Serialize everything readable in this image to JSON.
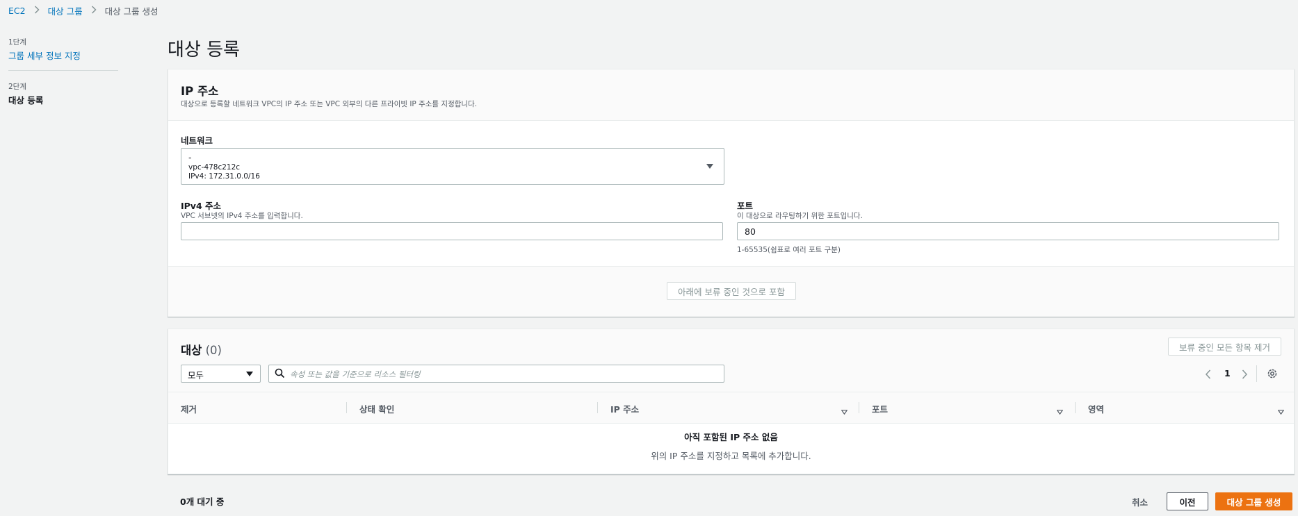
{
  "breadcrumb": {
    "items": [
      "EC2",
      "대상 그룹",
      "대상 그룹 생성"
    ]
  },
  "steps": [
    {
      "num": "1단계",
      "label": "그룹 세부 정보 지정"
    },
    {
      "num": "2단계",
      "label": "대상 등록"
    }
  ],
  "page_title": "대상 등록",
  "ip_panel": {
    "title": "IP 주소",
    "description": "대상으로 등록할 네트워크 VPC의 IP 주소 또는 VPC 외부의 다른 프라이빗 IP 주소를 지정합니다.",
    "network_label": "네트워크",
    "network_value": {
      "name": "-",
      "vpc_id": "vpc-478c212c",
      "cidr": "IPv4: 172.31.0.0/16"
    },
    "ipv4_label": "IPv4 주소",
    "ipv4_desc": "VPC 서브넷의 IPv4 주소를 입력합니다.",
    "ipv4_value": "",
    "port_label": "포트",
    "port_desc": "이 대상으로 라우팅하기 위한 포트입니다.",
    "port_value": "80",
    "port_hint": "1-65535(쉼표로 여러 포트 구분)",
    "include_button": "아래에 보류 중인 것으로 포함"
  },
  "targets_panel": {
    "title": "대상",
    "count": "(0)",
    "remove_all_button": "보류 중인 모든 항목 제거",
    "filter_select": "모두",
    "search_placeholder": "속성 또는 값을 기준으로 리소스 필터링",
    "page_number": "1",
    "columns": [
      "제거",
      "상태 확인",
      "IP 주소",
      "포트",
      "영역"
    ],
    "empty_title": "아직 포함된 IP 주소 없음",
    "empty_desc": "위의 IP 주소를 지정하고 목록에 추가합니다."
  },
  "footer": {
    "pending_count": "0개 대기 중",
    "cancel": "취소",
    "previous": "이전",
    "create": "대상 그룹 생성"
  },
  "colors": {
    "link": "#0073bb",
    "primary": "#ec7211",
    "background": "#f2f3f3"
  }
}
